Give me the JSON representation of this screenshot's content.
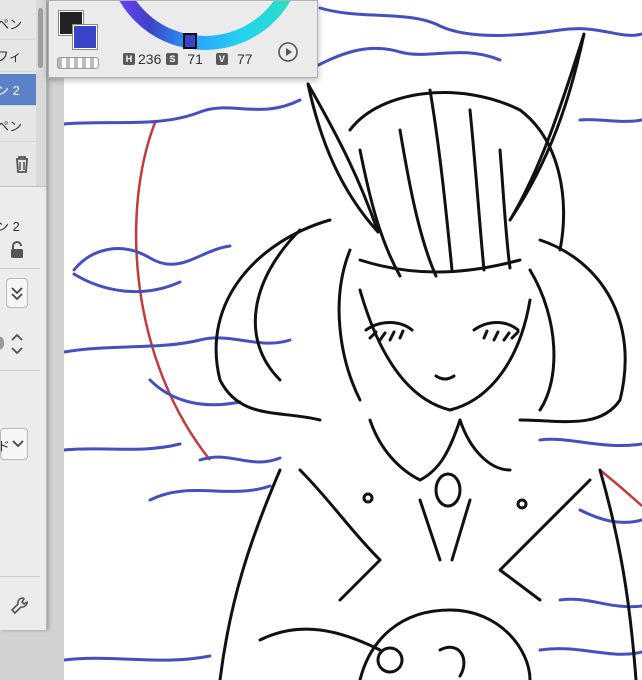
{
  "color_panel": {
    "hsv": {
      "h_tag": "H",
      "h_value": "236",
      "s_tag": "S",
      "s_value": "71",
      "v_tag": "V",
      "v_value": "77"
    },
    "main_color": "#222222",
    "sub_color": "#3b44c8"
  },
  "left_panel": {
    "sub_tools": [
      {
        "label": "ペン",
        "active": false
      },
      {
        "label": "フィ",
        "active": false
      },
      {
        "label": "ン 2",
        "active": true
      },
      {
        "label": "ペン",
        "active": false
      }
    ],
    "property_title": "ン 2",
    "dropdown_label": "ド"
  },
  "colors": {
    "accent": "#5b82c7",
    "blue_line": "#3b44c8",
    "red_line": "#c0392b"
  }
}
